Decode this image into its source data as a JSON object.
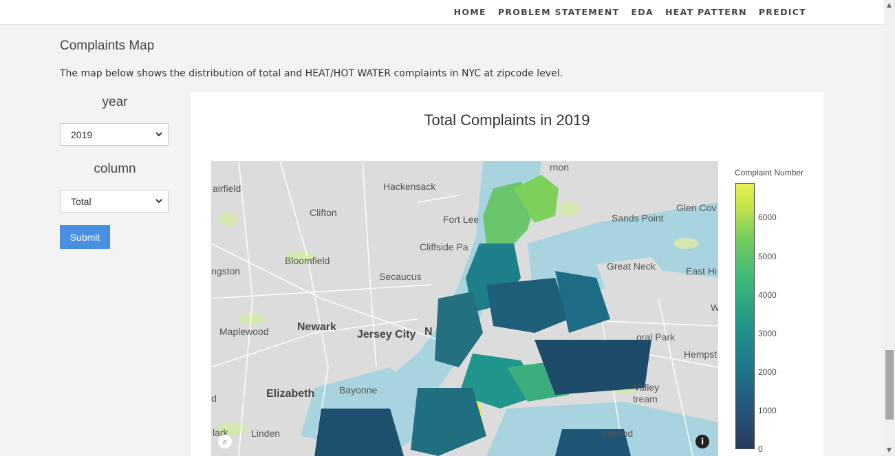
{
  "nav": {
    "items": [
      "HOME",
      "PROBLEM STATEMENT",
      "EDA",
      "HEAT PATTERN",
      "PREDICT"
    ]
  },
  "section": {
    "title": "Complaints Map",
    "description": "The map below shows the distribution of total and HEAT/HOT WATER complaints in NYC at zipcode level."
  },
  "form": {
    "year_label": "year",
    "year_value": "2019",
    "column_label": "column",
    "column_value": "Total",
    "submit_label": "Submit"
  },
  "chart_data": {
    "type": "heatmap",
    "title": "Total Complaints in 2019",
    "colorbar_title": "Complaint Number",
    "colorbar_ticks": [
      0,
      1000,
      2000,
      3000,
      4000,
      5000,
      6000
    ],
    "colorscale": "viridis"
  },
  "map": {
    "places": [
      "airfield",
      "Hackensack",
      "Clifton",
      "Fort Lee",
      "Cliffside Pa",
      "Bloomfield",
      "ngston",
      "Secaucus",
      "Newark",
      "Jersey City",
      "N",
      "Maplewood",
      "Elizabeth",
      "Bayonne",
      "Linden",
      "lark",
      "Sands Point",
      "Glen Cov",
      "Great Neck",
      "East Hi",
      "W",
      "oral Park",
      "Hempst",
      "Valley",
      "tream",
      "Inwood",
      "rnon",
      "d"
    ]
  },
  "colors": {
    "map_water": "#a8d4e0",
    "map_land": "#dcdcdc",
    "map_park": "#d4e8b0",
    "button": "#4a90e2"
  }
}
